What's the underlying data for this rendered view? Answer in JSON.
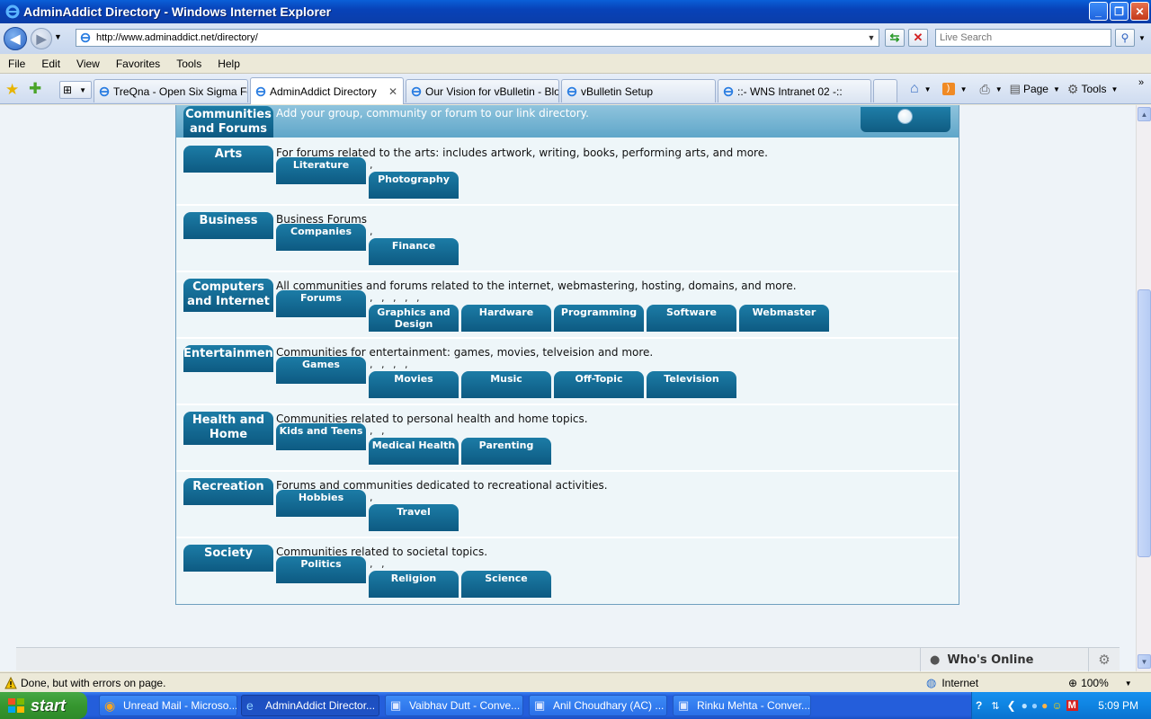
{
  "window": {
    "title": "AdminAddict Directory - Windows Internet Explorer"
  },
  "address": {
    "url": "http://www.adminaddict.net/directory/",
    "search_placeholder": "Live Search"
  },
  "menu": [
    "File",
    "Edit",
    "View",
    "Favorites",
    "Tools",
    "Help"
  ],
  "tabs": [
    {
      "label": "TreQna - Open Six Sigma Fo..."
    },
    {
      "label": "AdminAddict Directory"
    },
    {
      "label": "Our Vision for vBulletin - Blo..."
    },
    {
      "label": "vBulletin Setup"
    },
    {
      "label": "::- WNS Intranet 02 -::"
    }
  ],
  "command_bar": {
    "page_label": "Page",
    "tools_label": "Tools"
  },
  "directory": {
    "header": {
      "title": "Communities and Forums",
      "description": "Add your group, community or forum to our link directory."
    },
    "categories": [
      {
        "name": "Arts",
        "description": "For forums related to the arts: includes artwork, writing, books, performing arts, and more.",
        "commas": ",",
        "first": "Literature",
        "subs": [
          "Photography"
        ]
      },
      {
        "name": "Business",
        "description": "Business Forums",
        "commas": ",",
        "first": "Companies",
        "subs": [
          "Finance"
        ]
      },
      {
        "name": "Computers and Internet",
        "description": "All communities and forums related to the internet, webmastering, hosting, domains, and more.",
        "commas": ", , , , ,",
        "first": "Forums",
        "subs": [
          "Graphics and Design",
          "Hardware",
          "Programming",
          "Software",
          "Webmaster"
        ]
      },
      {
        "name": "Entertainmen",
        "description": "Communities for entertainment: games, movies, telveision and more.",
        "commas": ", , , ,",
        "first": "Games",
        "subs": [
          "Movies",
          "Music",
          "Off-Topic",
          "Television"
        ]
      },
      {
        "name": "Health and Home",
        "description": "Communities related to personal health and home topics.",
        "commas": ", ,",
        "first": "Kids and Teens",
        "subs": [
          "Medical Health",
          "Parenting"
        ]
      },
      {
        "name": "Recreation",
        "description": "Forums and communities dedicated to recreational activities.",
        "commas": ",",
        "first": "Hobbies",
        "subs": [
          "Travel"
        ]
      },
      {
        "name": "Society",
        "description": "Communities related to societal topics.",
        "commas": ", ,",
        "first": "Politics",
        "subs": [
          "Religion",
          "Science"
        ]
      }
    ]
  },
  "whos_online": "Who's Online",
  "status": {
    "text": "Done, but with errors on page.",
    "zone": "Internet",
    "zoom": "100%"
  },
  "taskbar": {
    "start": "start",
    "items": [
      {
        "label": "Unread Mail - Microso..."
      },
      {
        "label": "AdminAddict Director..."
      },
      {
        "label": "Vaibhav Dutt - Conve..."
      },
      {
        "label": "Anil Choudhary (AC) ..."
      },
      {
        "label": "Rinku Mehta - Conver..."
      }
    ],
    "clock": "5:09 PM"
  },
  "colors": {
    "accent": "#0d5a82",
    "header": "#5fa6c9",
    "titlebar": "#0842b8"
  }
}
